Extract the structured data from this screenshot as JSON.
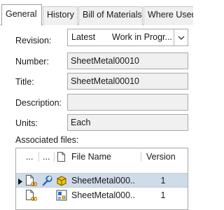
{
  "tabs": [
    {
      "label": "General",
      "active": true
    },
    {
      "label": "History",
      "active": false
    },
    {
      "label": "Bill of Materials",
      "active": false
    },
    {
      "label": "Where Used",
      "active": false
    }
  ],
  "form": {
    "revision_label": "Revision:",
    "revision_value": "Latest",
    "revision_state": "Work in Progr...",
    "number_label": "Number:",
    "number_value": "SheetMetal00010",
    "title_label": "Title:",
    "title_value": "SheetMetal00010",
    "description_label": "Description:",
    "description_value": "",
    "units_label": "Units:",
    "units_value": "Each"
  },
  "associated": {
    "label": "Associated files:",
    "columns": {
      "col1": "...",
      "col2": "...",
      "file_name": "File Name",
      "version": "Version"
    },
    "rows": [
      {
        "name": "SheetMetal000...",
        "version": "1",
        "selected": true
      },
      {
        "name": "SheetMetal000...",
        "version": "1",
        "selected": false
      }
    ]
  },
  "colors": {
    "selected_row": "#cfdbe8",
    "field_bg": "#f0f0f0"
  }
}
